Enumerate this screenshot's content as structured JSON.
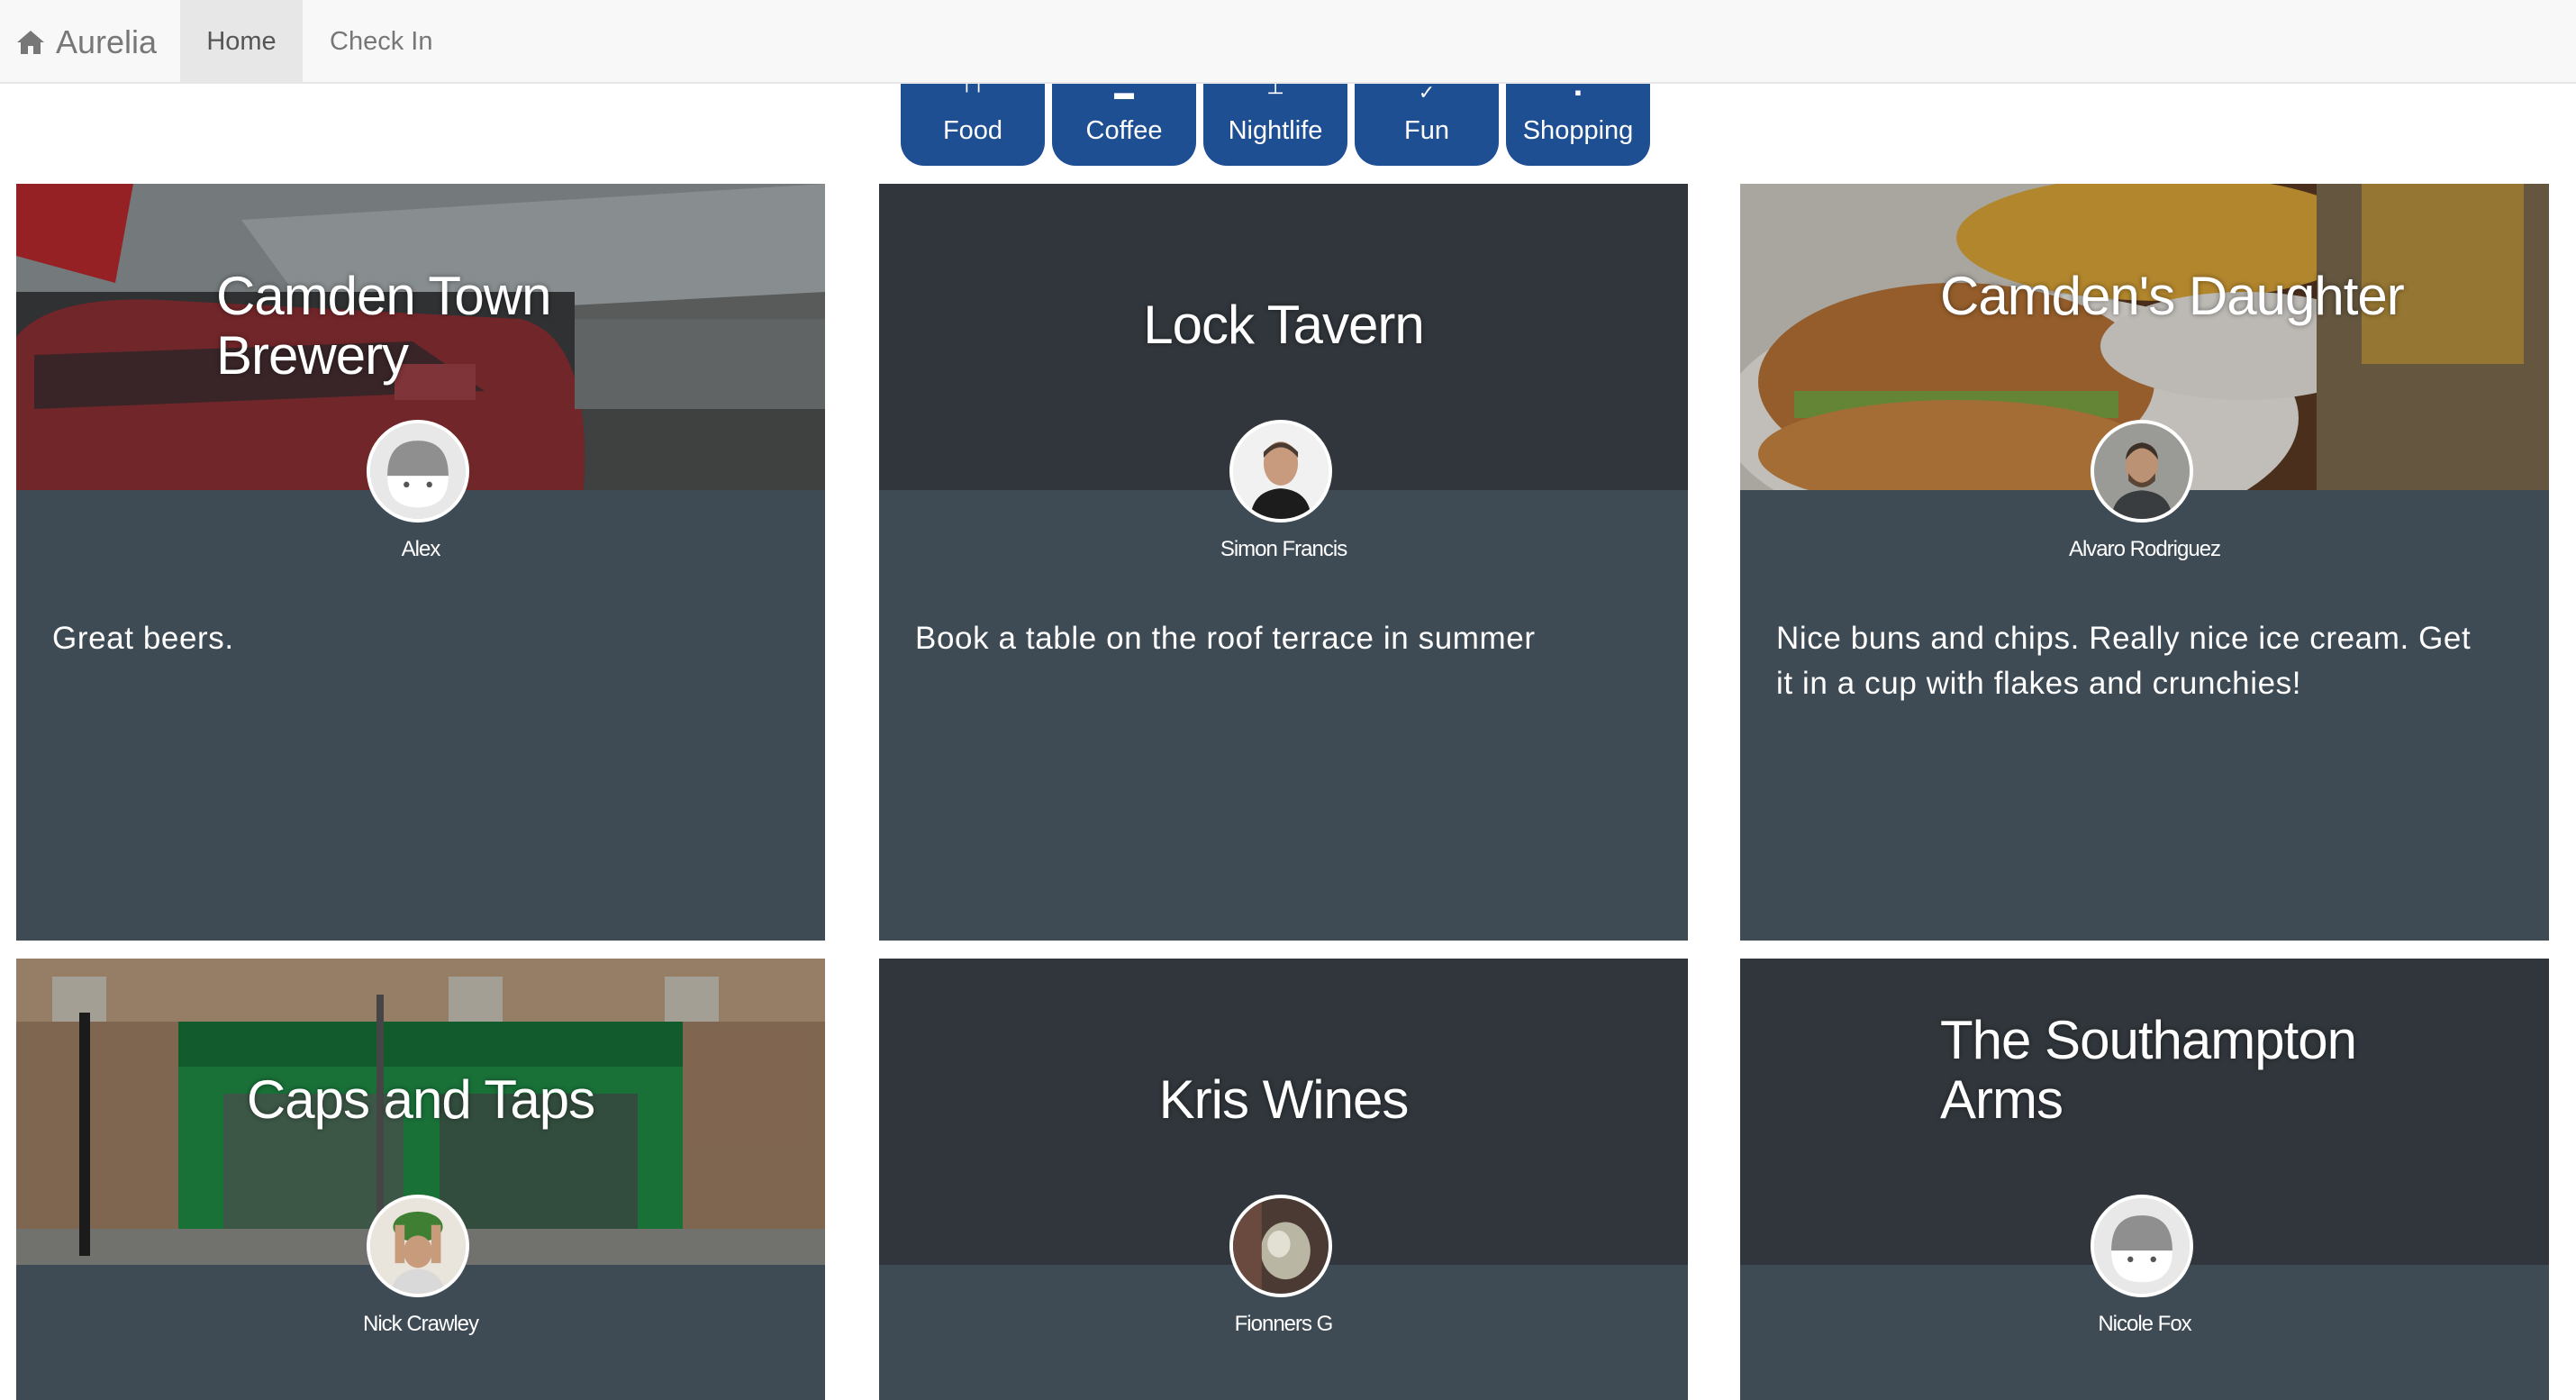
{
  "navbar": {
    "brand": "Aurelia",
    "brand_icon": "home-icon",
    "items": [
      {
        "label": "Home",
        "active": true
      },
      {
        "label": "Check In",
        "active": false
      }
    ]
  },
  "categories": [
    {
      "label": "Food",
      "icon": "fork-knife-icon"
    },
    {
      "label": "Coffee",
      "icon": "coffee-cup-icon"
    },
    {
      "label": "Nightlife",
      "icon": "cocktail-glass-icon"
    },
    {
      "label": "Fun",
      "icon": "ticket-icon"
    },
    {
      "label": "Shopping",
      "icon": "shopping-bag-icon"
    }
  ],
  "colors": {
    "category_button": "#1e4f93",
    "card_body": "#3e4b55",
    "card_header": "#30363b",
    "navbar": "#f8f8f8"
  },
  "places": [
    {
      "name": "Camden Town Brewery",
      "user": "Alex",
      "comment": "Great beers.",
      "photo": "brewery-street-photo",
      "avatar": "default-avatar-icon"
    },
    {
      "name": "Lock Tavern",
      "user": "Simon Francis",
      "comment": "Book a table on the roof terrace in summer",
      "photo": "",
      "avatar": "user-photo-avatar"
    },
    {
      "name": "Camden's Daughter",
      "user": "Alvaro Rodriguez",
      "comment": "Nice buns and chips. Really nice ice cream. Get it in a cup with flakes and crunchies!",
      "photo": "burger-and-chips-photo",
      "avatar": "user-photo-avatar"
    },
    {
      "name": "Caps and Taps",
      "user": "Nick Crawley",
      "comment": "",
      "photo": "green-shopfront-photo",
      "avatar": "user-photo-avatar"
    },
    {
      "name": "Kris Wines",
      "user": "Fionners G",
      "comment": "",
      "photo": "",
      "avatar": "user-photo-avatar"
    },
    {
      "name": "The Southampton Arms",
      "user": "Nicole Fox",
      "comment": "",
      "photo": "",
      "avatar": "default-avatar-icon"
    }
  ]
}
